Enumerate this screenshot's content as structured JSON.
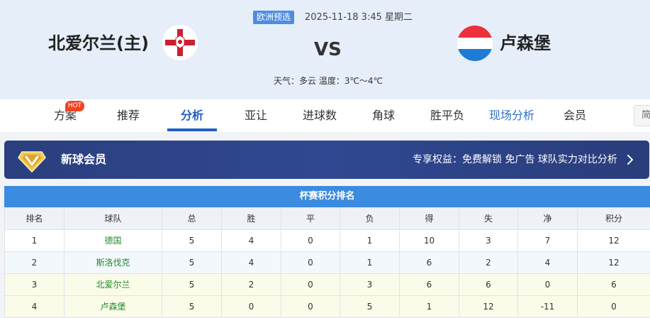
{
  "match": {
    "competition": "欧洲预选",
    "datetime": "2025-11-18 3:45 星期二",
    "home_team": "北爱尔兰(主)",
    "away_team": "卢森堡",
    "vs": "VS",
    "weather": "天气：多云 温度：3℃～4℃"
  },
  "nav": {
    "hot_badge": "HOT",
    "tabs": [
      {
        "label": "方案"
      },
      {
        "label": "推荐"
      },
      {
        "label": "分析"
      },
      {
        "label": "亚让"
      },
      {
        "label": "进球数"
      },
      {
        "label": "角球"
      },
      {
        "label": "胜平负"
      },
      {
        "label": "现场分析"
      },
      {
        "label": "会员"
      }
    ],
    "extra": "简"
  },
  "banner": {
    "title": "新球会员",
    "benefits": "专享权益：免费解锁 免广告 球队实力对比分析"
  },
  "standings": {
    "title": "杯赛积分排名",
    "headers": [
      "排名",
      "球队",
      "总",
      "胜",
      "平",
      "负",
      "得",
      "失",
      "净",
      "积分"
    ],
    "rows": [
      [
        "1",
        "德国",
        "5",
        "4",
        "0",
        "1",
        "10",
        "3",
        "7",
        "12"
      ],
      [
        "2",
        "斯洛伐克",
        "5",
        "4",
        "0",
        "1",
        "6",
        "2",
        "4",
        "12"
      ],
      [
        "3",
        "北爱尔兰",
        "5",
        "2",
        "0",
        "3",
        "6",
        "6",
        "0",
        "6"
      ],
      [
        "4",
        "卢森堡",
        "5",
        "0",
        "0",
        "5",
        "1",
        "12",
        "-11",
        "0"
      ]
    ]
  },
  "colors": {
    "accent": "#2060c8",
    "table_header": "#3b8be0",
    "banner": "#2f4891",
    "team_link": "#1f8a2c",
    "hot": "#f04422"
  }
}
